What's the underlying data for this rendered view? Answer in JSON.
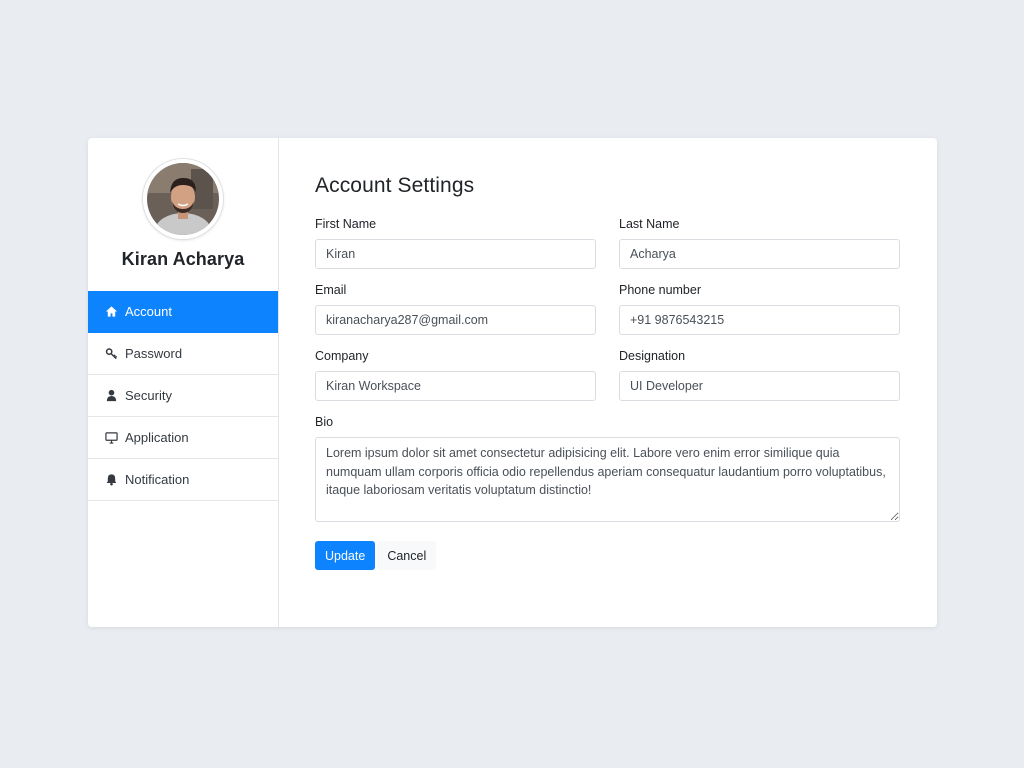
{
  "user": {
    "name": "Kiran Acharya",
    "avatar_icon": "user-avatar-photo"
  },
  "sidebar": {
    "items": [
      {
        "label": "Account",
        "icon": "home-icon",
        "active": true
      },
      {
        "label": "Password",
        "icon": "key-icon",
        "active": false
      },
      {
        "label": "Security",
        "icon": "user-icon",
        "active": false
      },
      {
        "label": "Application",
        "icon": "monitor-icon",
        "active": false
      },
      {
        "label": "Notification",
        "icon": "bell-icon",
        "active": false
      }
    ]
  },
  "main": {
    "title": "Account Settings",
    "fields": {
      "first_name": {
        "label": "First Name",
        "value": "Kiran"
      },
      "last_name": {
        "label": "Last Name",
        "value": "Acharya"
      },
      "email": {
        "label": "Email",
        "value": "kiranacharya287@gmail.com"
      },
      "phone": {
        "label": "Phone number",
        "value": "+91 9876543215"
      },
      "company": {
        "label": "Company",
        "value": "Kiran Workspace"
      },
      "designation": {
        "label": "Designation",
        "value": "UI Developer"
      }
    },
    "bio": {
      "label": "Bio",
      "value": "Lorem ipsum dolor sit amet consectetur adipisicing elit. Labore vero enim error similique quia numquam ullam corporis officia odio repellendus aperiam consequatur laudantium porro voluptatibus, itaque laboriosam veritatis voluptatum distinctio!"
    },
    "actions": {
      "update_label": "Update",
      "cancel_label": "Cancel"
    }
  },
  "colors": {
    "accent": "#0d83fd",
    "background": "#e9edf1",
    "card": "#ffffff"
  }
}
